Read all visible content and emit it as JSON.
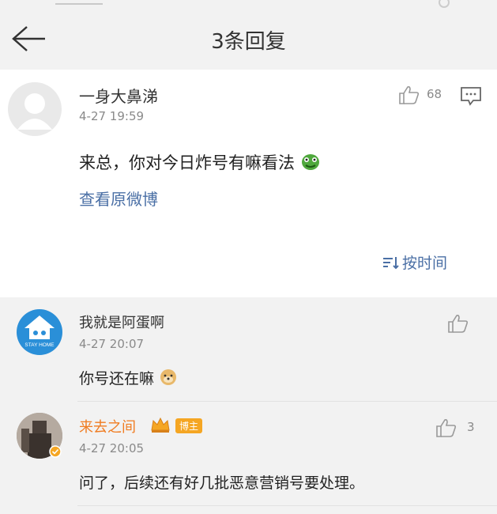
{
  "header": {
    "title": "3条回复"
  },
  "main_comment": {
    "username": "一身大鼻涕",
    "time": "4-27 19:59",
    "like_count": "68",
    "content": "来总，你对今日炸号有嘛看法",
    "view_original": "查看原微博",
    "sort_label": "按时间"
  },
  "replies": [
    {
      "username": "我就是阿蛋啊",
      "time": "4-27 20:07",
      "content": "你号还在嘛",
      "avatar_text": "STAY HOME"
    },
    {
      "username": "来去之间",
      "badge": "博主",
      "time": "4-27 20:05",
      "like_count": "3",
      "content": "问了，后续还有好几批恶意营销号要处理。"
    }
  ],
  "colors": {
    "link": "#4a6fa5",
    "author_name": "#f07c21",
    "badge": "#f5a623",
    "background": "#f2f2f2"
  },
  "icons": [
    "back-arrow-icon",
    "thumbs-up-icon",
    "comment-icon",
    "sort-icon",
    "crown-icon",
    "verified-icon",
    "alien-emoji-icon",
    "doge-emoji-icon"
  ]
}
